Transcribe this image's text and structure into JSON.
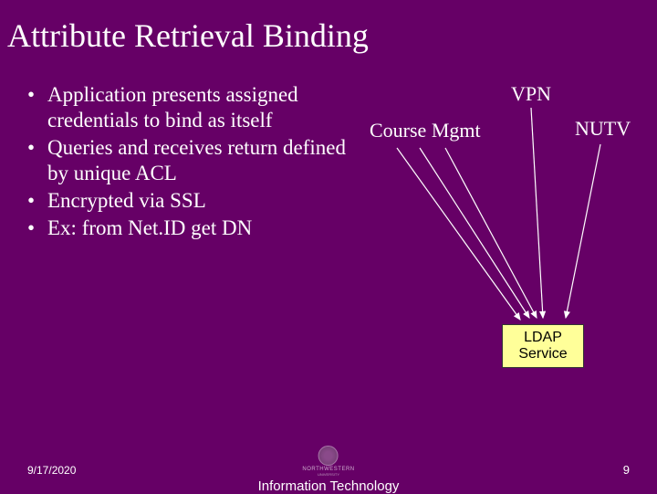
{
  "title": "Attribute Retrieval Binding",
  "bullets": [
    "Application presents assigned credentials to bind as itself",
    "Queries and receives return defined by unique ACL",
    "Encrypted via SSL",
    "Ex: from Net.ID get DN"
  ],
  "diagram": {
    "vpn": "VPN",
    "course_mgmt": "Course Mgmt",
    "nutv": "NUTV",
    "ldap_line1": "LDAP",
    "ldap_line2": "Service"
  },
  "footer": {
    "date": "9/17/2020",
    "center": "Information Technology",
    "logo_main": "NORTHWESTERN",
    "logo_sub": "UNIVERSITY",
    "page": "9"
  }
}
